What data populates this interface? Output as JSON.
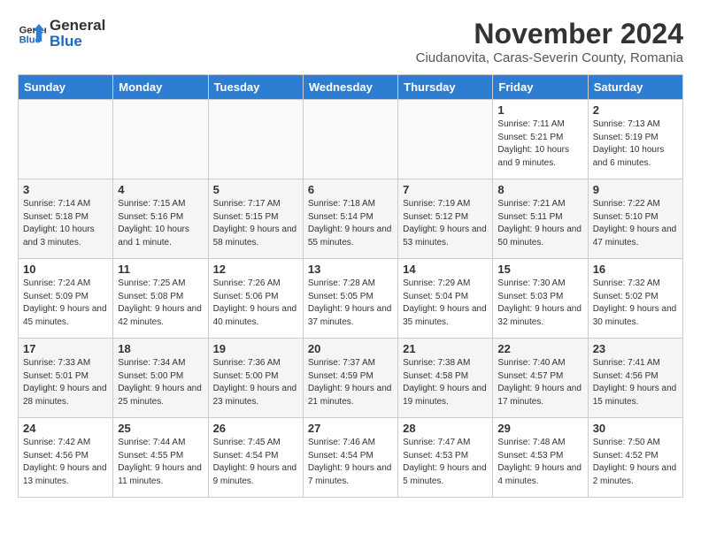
{
  "header": {
    "logo_general": "General",
    "logo_blue": "Blue",
    "title": "November 2024",
    "subtitle": "Ciudanovita, Caras-Severin County, Romania"
  },
  "days_of_week": [
    "Sunday",
    "Monday",
    "Tuesday",
    "Wednesday",
    "Thursday",
    "Friday",
    "Saturday"
  ],
  "weeks": [
    [
      {
        "day": "",
        "info": ""
      },
      {
        "day": "",
        "info": ""
      },
      {
        "day": "",
        "info": ""
      },
      {
        "day": "",
        "info": ""
      },
      {
        "day": "",
        "info": ""
      },
      {
        "day": "1",
        "info": "Sunrise: 7:11 AM\nSunset: 5:21 PM\nDaylight: 10 hours and 9 minutes."
      },
      {
        "day": "2",
        "info": "Sunrise: 7:13 AM\nSunset: 5:19 PM\nDaylight: 10 hours and 6 minutes."
      }
    ],
    [
      {
        "day": "3",
        "info": "Sunrise: 7:14 AM\nSunset: 5:18 PM\nDaylight: 10 hours and 3 minutes."
      },
      {
        "day": "4",
        "info": "Sunrise: 7:15 AM\nSunset: 5:16 PM\nDaylight: 10 hours and 1 minute."
      },
      {
        "day": "5",
        "info": "Sunrise: 7:17 AM\nSunset: 5:15 PM\nDaylight: 9 hours and 58 minutes."
      },
      {
        "day": "6",
        "info": "Sunrise: 7:18 AM\nSunset: 5:14 PM\nDaylight: 9 hours and 55 minutes."
      },
      {
        "day": "7",
        "info": "Sunrise: 7:19 AM\nSunset: 5:12 PM\nDaylight: 9 hours and 53 minutes."
      },
      {
        "day": "8",
        "info": "Sunrise: 7:21 AM\nSunset: 5:11 PM\nDaylight: 9 hours and 50 minutes."
      },
      {
        "day": "9",
        "info": "Sunrise: 7:22 AM\nSunset: 5:10 PM\nDaylight: 9 hours and 47 minutes."
      }
    ],
    [
      {
        "day": "10",
        "info": "Sunrise: 7:24 AM\nSunset: 5:09 PM\nDaylight: 9 hours and 45 minutes."
      },
      {
        "day": "11",
        "info": "Sunrise: 7:25 AM\nSunset: 5:08 PM\nDaylight: 9 hours and 42 minutes."
      },
      {
        "day": "12",
        "info": "Sunrise: 7:26 AM\nSunset: 5:06 PM\nDaylight: 9 hours and 40 minutes."
      },
      {
        "day": "13",
        "info": "Sunrise: 7:28 AM\nSunset: 5:05 PM\nDaylight: 9 hours and 37 minutes."
      },
      {
        "day": "14",
        "info": "Sunrise: 7:29 AM\nSunset: 5:04 PM\nDaylight: 9 hours and 35 minutes."
      },
      {
        "day": "15",
        "info": "Sunrise: 7:30 AM\nSunset: 5:03 PM\nDaylight: 9 hours and 32 minutes."
      },
      {
        "day": "16",
        "info": "Sunrise: 7:32 AM\nSunset: 5:02 PM\nDaylight: 9 hours and 30 minutes."
      }
    ],
    [
      {
        "day": "17",
        "info": "Sunrise: 7:33 AM\nSunset: 5:01 PM\nDaylight: 9 hours and 28 minutes."
      },
      {
        "day": "18",
        "info": "Sunrise: 7:34 AM\nSunset: 5:00 PM\nDaylight: 9 hours and 25 minutes."
      },
      {
        "day": "19",
        "info": "Sunrise: 7:36 AM\nSunset: 5:00 PM\nDaylight: 9 hours and 23 minutes."
      },
      {
        "day": "20",
        "info": "Sunrise: 7:37 AM\nSunset: 4:59 PM\nDaylight: 9 hours and 21 minutes."
      },
      {
        "day": "21",
        "info": "Sunrise: 7:38 AM\nSunset: 4:58 PM\nDaylight: 9 hours and 19 minutes."
      },
      {
        "day": "22",
        "info": "Sunrise: 7:40 AM\nSunset: 4:57 PM\nDaylight: 9 hours and 17 minutes."
      },
      {
        "day": "23",
        "info": "Sunrise: 7:41 AM\nSunset: 4:56 PM\nDaylight: 9 hours and 15 minutes."
      }
    ],
    [
      {
        "day": "24",
        "info": "Sunrise: 7:42 AM\nSunset: 4:56 PM\nDaylight: 9 hours and 13 minutes."
      },
      {
        "day": "25",
        "info": "Sunrise: 7:44 AM\nSunset: 4:55 PM\nDaylight: 9 hours and 11 minutes."
      },
      {
        "day": "26",
        "info": "Sunrise: 7:45 AM\nSunset: 4:54 PM\nDaylight: 9 hours and 9 minutes."
      },
      {
        "day": "27",
        "info": "Sunrise: 7:46 AM\nSunset: 4:54 PM\nDaylight: 9 hours and 7 minutes."
      },
      {
        "day": "28",
        "info": "Sunrise: 7:47 AM\nSunset: 4:53 PM\nDaylight: 9 hours and 5 minutes."
      },
      {
        "day": "29",
        "info": "Sunrise: 7:48 AM\nSunset: 4:53 PM\nDaylight: 9 hours and 4 minutes."
      },
      {
        "day": "30",
        "info": "Sunrise: 7:50 AM\nSunset: 4:52 PM\nDaylight: 9 hours and 2 minutes."
      }
    ]
  ]
}
